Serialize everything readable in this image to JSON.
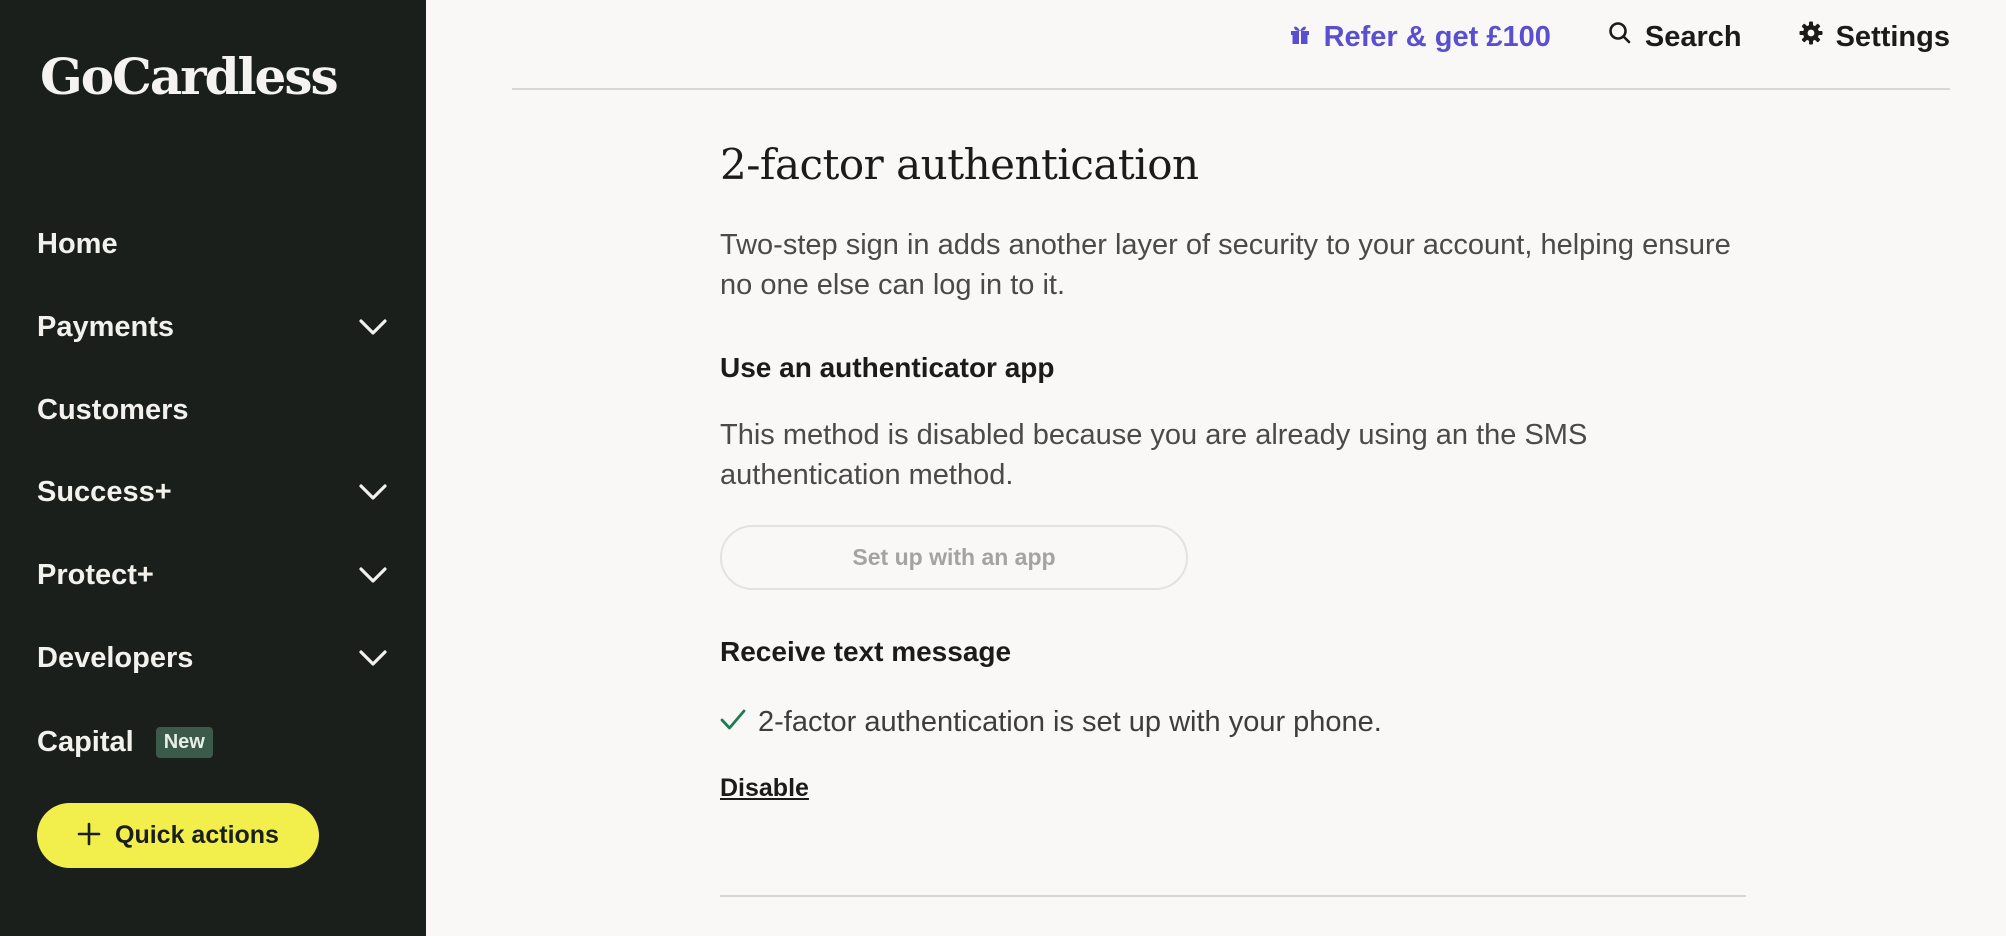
{
  "brand": {
    "logo_text": "GoCardless"
  },
  "sidebar": {
    "items": [
      {
        "label": "Home",
        "has_chevron": false
      },
      {
        "label": "Payments",
        "has_chevron": true
      },
      {
        "label": "Customers",
        "has_chevron": false
      },
      {
        "label": "Success+",
        "has_chevron": true
      },
      {
        "label": "Protect+",
        "has_chevron": true
      },
      {
        "label": "Developers",
        "has_chevron": true
      },
      {
        "label": "Capital",
        "has_chevron": false,
        "badge": "New"
      }
    ],
    "quick_actions_label": "Quick actions"
  },
  "topbar": {
    "refer_label": "Refer & get £100",
    "search_label": "Search",
    "settings_label": "Settings"
  },
  "main": {
    "title": "2-factor authentication",
    "intro": "Two-step sign in adds another layer of security to your account, helping ensure no one else can log in to it.",
    "app_section": {
      "heading": "Use an authenticator app",
      "description": "This method is disabled because you are already using an the SMS authentication method.",
      "button_label": "Set up with an app"
    },
    "sms_section": {
      "heading": "Receive text message",
      "status": "2-factor authentication is set up with your phone.",
      "disable_label": "Disable"
    }
  },
  "colors": {
    "sidebar_bg": "#1a1f1c",
    "page_bg": "#f9f8f6",
    "accent_yellow": "#f2ef4d",
    "link_purple": "#5a4fcf",
    "success_green": "#1f7a4f",
    "badge_bg": "#3b5a49"
  },
  "icons": [
    "gift-icon",
    "search-icon",
    "gear-icon",
    "chevron-down-icon",
    "plus-icon",
    "check-icon"
  ]
}
